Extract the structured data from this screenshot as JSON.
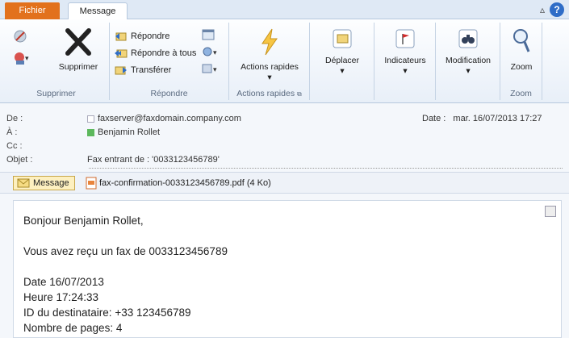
{
  "tabs": {
    "file": "Fichier",
    "message": "Message"
  },
  "ribbon": {
    "supprimer": {
      "delete_label": "Supprimer",
      "group_label": "Supprimer"
    },
    "repondre": {
      "reply": "Répondre",
      "reply_all": "Répondre à tous",
      "forward": "Transférer",
      "group_label": "Répondre"
    },
    "actions": {
      "quick_actions": "Actions rapides",
      "group_label": "Actions rapides"
    },
    "deplacer": {
      "label": "Déplacer"
    },
    "indicateurs": {
      "label": "Indicateurs"
    },
    "modification": {
      "label": "Modification"
    },
    "zoom": {
      "label": "Zoom",
      "group_label": "Zoom"
    }
  },
  "header": {
    "from_label": "De :",
    "from_value": "faxserver@faxdomain.company.com",
    "to_label": "À :",
    "to_value": "Benjamin Rollet",
    "cc_label": "Cc :",
    "subject_label": "Objet :",
    "subject_value": "Fax entrant de : '0033123456789'",
    "date_label": "Date :",
    "date_value": "mar. 16/07/2013 17:27"
  },
  "attachments": {
    "message": "Message",
    "file": "fax-confirmation-0033123456789.pdf (4 Ko)"
  },
  "body": {
    "greeting": "Bonjour Benjamin Rollet,",
    "line1": "Vous avez reçu un fax de 0033123456789",
    "date": "Date 16/07/2013",
    "time": "Heure 17:24:33",
    "recipient": "ID du destinataire: +33 123456789",
    "pages": "Nombre de pages: 4"
  },
  "colors": {
    "file_tab": "#e2711d",
    "ribbon_bg": "#e8eff8",
    "accent": "#2f6dc7"
  }
}
